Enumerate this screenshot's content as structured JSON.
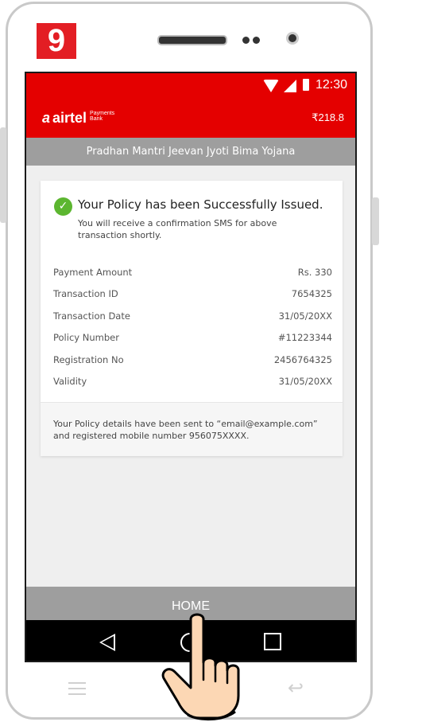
{
  "step": "9",
  "status_bar": {
    "time": "12:30"
  },
  "app_bar": {
    "logo_mark": "a",
    "logo_word": "airtel",
    "logo_sub": "Payments Bank",
    "balance": "₹218.8"
  },
  "scheme_title": "Pradhan Mantri Jeevan Jyoti Bima Yojana",
  "card": {
    "title": "Your Policy has been Successfully  Issued.",
    "subtitle": "You will receive a confirmation SMS for above transaction shortly.",
    "rows": [
      {
        "label": "Payment Amount",
        "value": "Rs. 330"
      },
      {
        "label": "Transaction ID",
        "value": "7654325"
      },
      {
        "label": "Transaction Date",
        "value": "31/05/20XX"
      },
      {
        "label": "Policy Number",
        "value": "#11223344"
      },
      {
        "label": "Registration No",
        "value": "2456764325"
      },
      {
        "label": "Validity",
        "value": "31/05/20XX"
      }
    ],
    "footer": "Your Policy details have been sent to “email@example.com” and registered mobile number 956075XXXX."
  },
  "home_button": "HOME",
  "icons": {
    "wifi": "wifi-icon",
    "signal": "signal-icon",
    "battery": "battery-icon",
    "check": "check-icon",
    "back": "back-icon",
    "home": "home-icon",
    "recent": "recent-apps-icon",
    "hand": "pointing-hand-icon"
  },
  "colors": {
    "brand_red": "#e40000",
    "badge_red": "#e31e24",
    "success_green": "#5cb630",
    "bar_gray": "#9e9e9e"
  }
}
